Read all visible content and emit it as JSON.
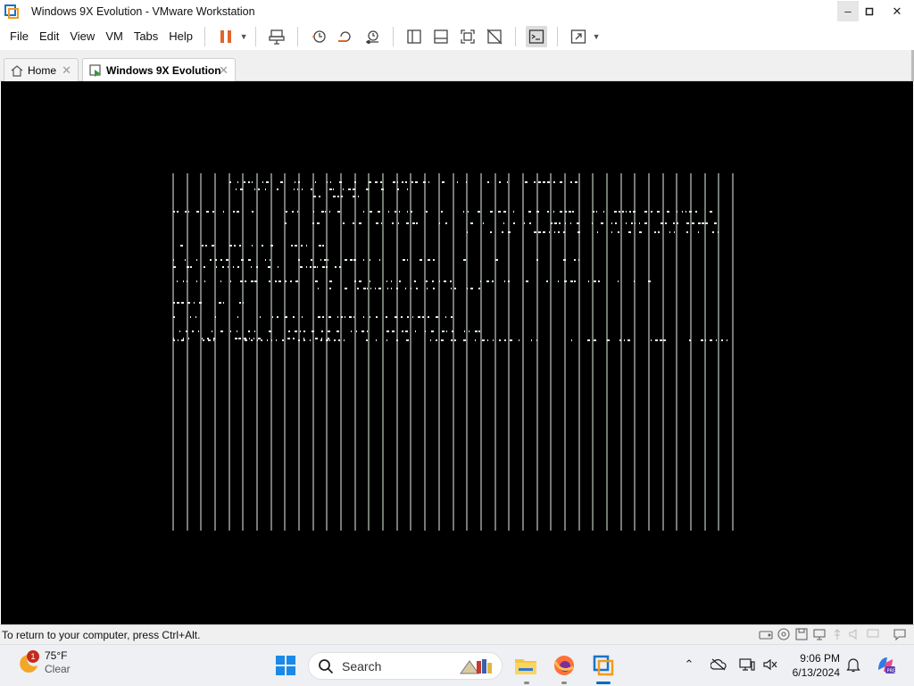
{
  "window": {
    "title": "Windows 9X Evolution - VMware Workstation",
    "minimize_icon": "minimize-icon",
    "maximize_icon": "maximize-icon",
    "close_icon": "close-icon"
  },
  "menu": {
    "items": [
      "File",
      "Edit",
      "View",
      "VM",
      "Tabs",
      "Help"
    ]
  },
  "toolbar": {
    "icons": [
      "pause-icon",
      "send-ctrl-alt-del-icon",
      "snapshot-icon",
      "revert-snapshot-icon",
      "snapshot-manager-icon",
      "show-library-icon",
      "thumbnail-bar-icon",
      "full-screen-icon",
      "unity-icon",
      "console-view-icon",
      "stretch-guest-icon"
    ]
  },
  "tabs": [
    {
      "label": "Home",
      "active": false
    },
    {
      "label": "Windows 9X Evolution",
      "active": true
    }
  ],
  "statusbar": {
    "message": "To return to your computer, press Ctrl+Alt."
  },
  "taskbar": {
    "weather": {
      "temp": "75°F",
      "condition": "Clear",
      "badge": "1"
    },
    "search_placeholder": "Search",
    "clock_time": "9:06 PM",
    "clock_date": "6/13/2024"
  },
  "colors": {
    "pause_orange": "#e0662a",
    "vm_screen_bg": "#000000",
    "glitch_lines": "#e8f2e8",
    "taskbar_bg": "#eef0f3"
  }
}
